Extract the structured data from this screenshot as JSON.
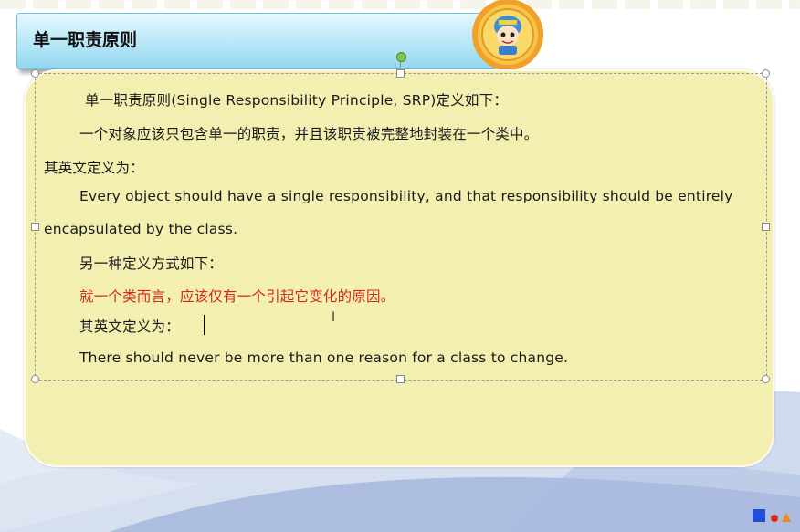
{
  "slide": {
    "title": "单一职责原则",
    "lines": {
      "l1": "单一职责原则(Single Responsibility Principle, SRP)定义如下：",
      "l2": "一个对象应该只包含单一的职责，并且该职责被完整地封装在一个类中。",
      "l3": "其英文定义为：",
      "l4": "Every object should have a single responsibility, and that responsibility should be entirely",
      "l5": "encapsulated by the class.",
      "l6": "另一种定义方式如下：",
      "l7": "就一个类而言，应该仅有一个引起它变化的原因。",
      "l8": "其英文定义为：",
      "l9": "There should never be more than one reason for a class to change."
    }
  },
  "colors": {
    "content_background": "#f2efb1",
    "highlight_text": "#d22a1a",
    "title_bar": "#bfeaf8"
  },
  "icons": {
    "badge": "cartoon-mascot-badge",
    "logo": "blue-square-red-dot-orange-triangle-logo"
  }
}
